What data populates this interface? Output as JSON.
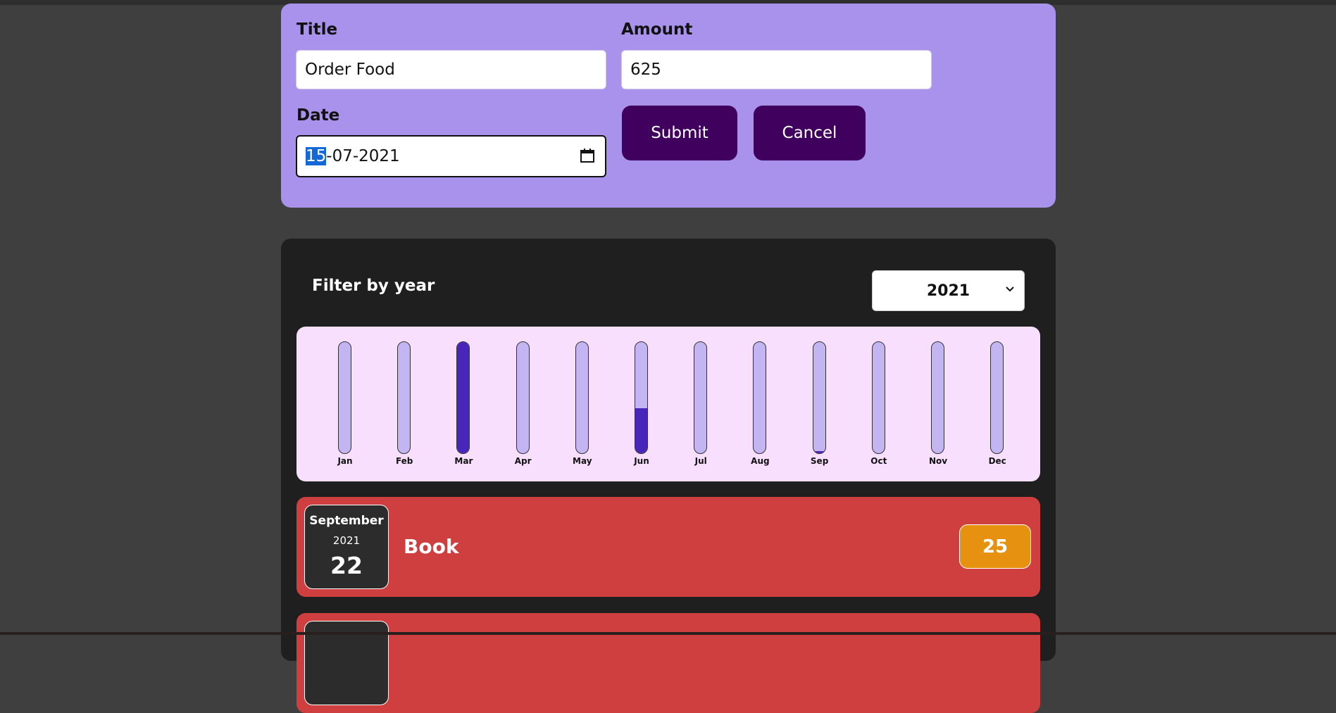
{
  "form": {
    "title_label": "Title",
    "title_value": "Order Food",
    "amount_label": "Amount",
    "amount_value": "625",
    "date_label": "Date",
    "date_day": "15",
    "date_rest": "-07-2021",
    "submit_label": "Submit",
    "cancel_label": "Cancel"
  },
  "filter": {
    "label": "Filter by year",
    "selected_year": "2021"
  },
  "chart_data": {
    "type": "bar",
    "categories": [
      "Jan",
      "Feb",
      "Mar",
      "Apr",
      "May",
      "Jun",
      "Jul",
      "Aug",
      "Sep",
      "Oct",
      "Nov",
      "Dec"
    ],
    "values": [
      0,
      0,
      1.0,
      0,
      0,
      0.4,
      0,
      0,
      0.02,
      0,
      0,
      0
    ],
    "ylim": [
      0,
      1
    ]
  },
  "expenses": [
    {
      "month": "September",
      "year": "2021",
      "day": "22",
      "title": "Book",
      "amount": "25"
    }
  ],
  "colors": {
    "form_bg": "#a892ec",
    "button_bg": "#40005d",
    "chart_bg": "#f8dffe",
    "bar_empty": "#c3b4f2",
    "bar_fill": "#4826b9",
    "item_bg": "#cf3f3f",
    "price_bg": "#e6910f"
  }
}
